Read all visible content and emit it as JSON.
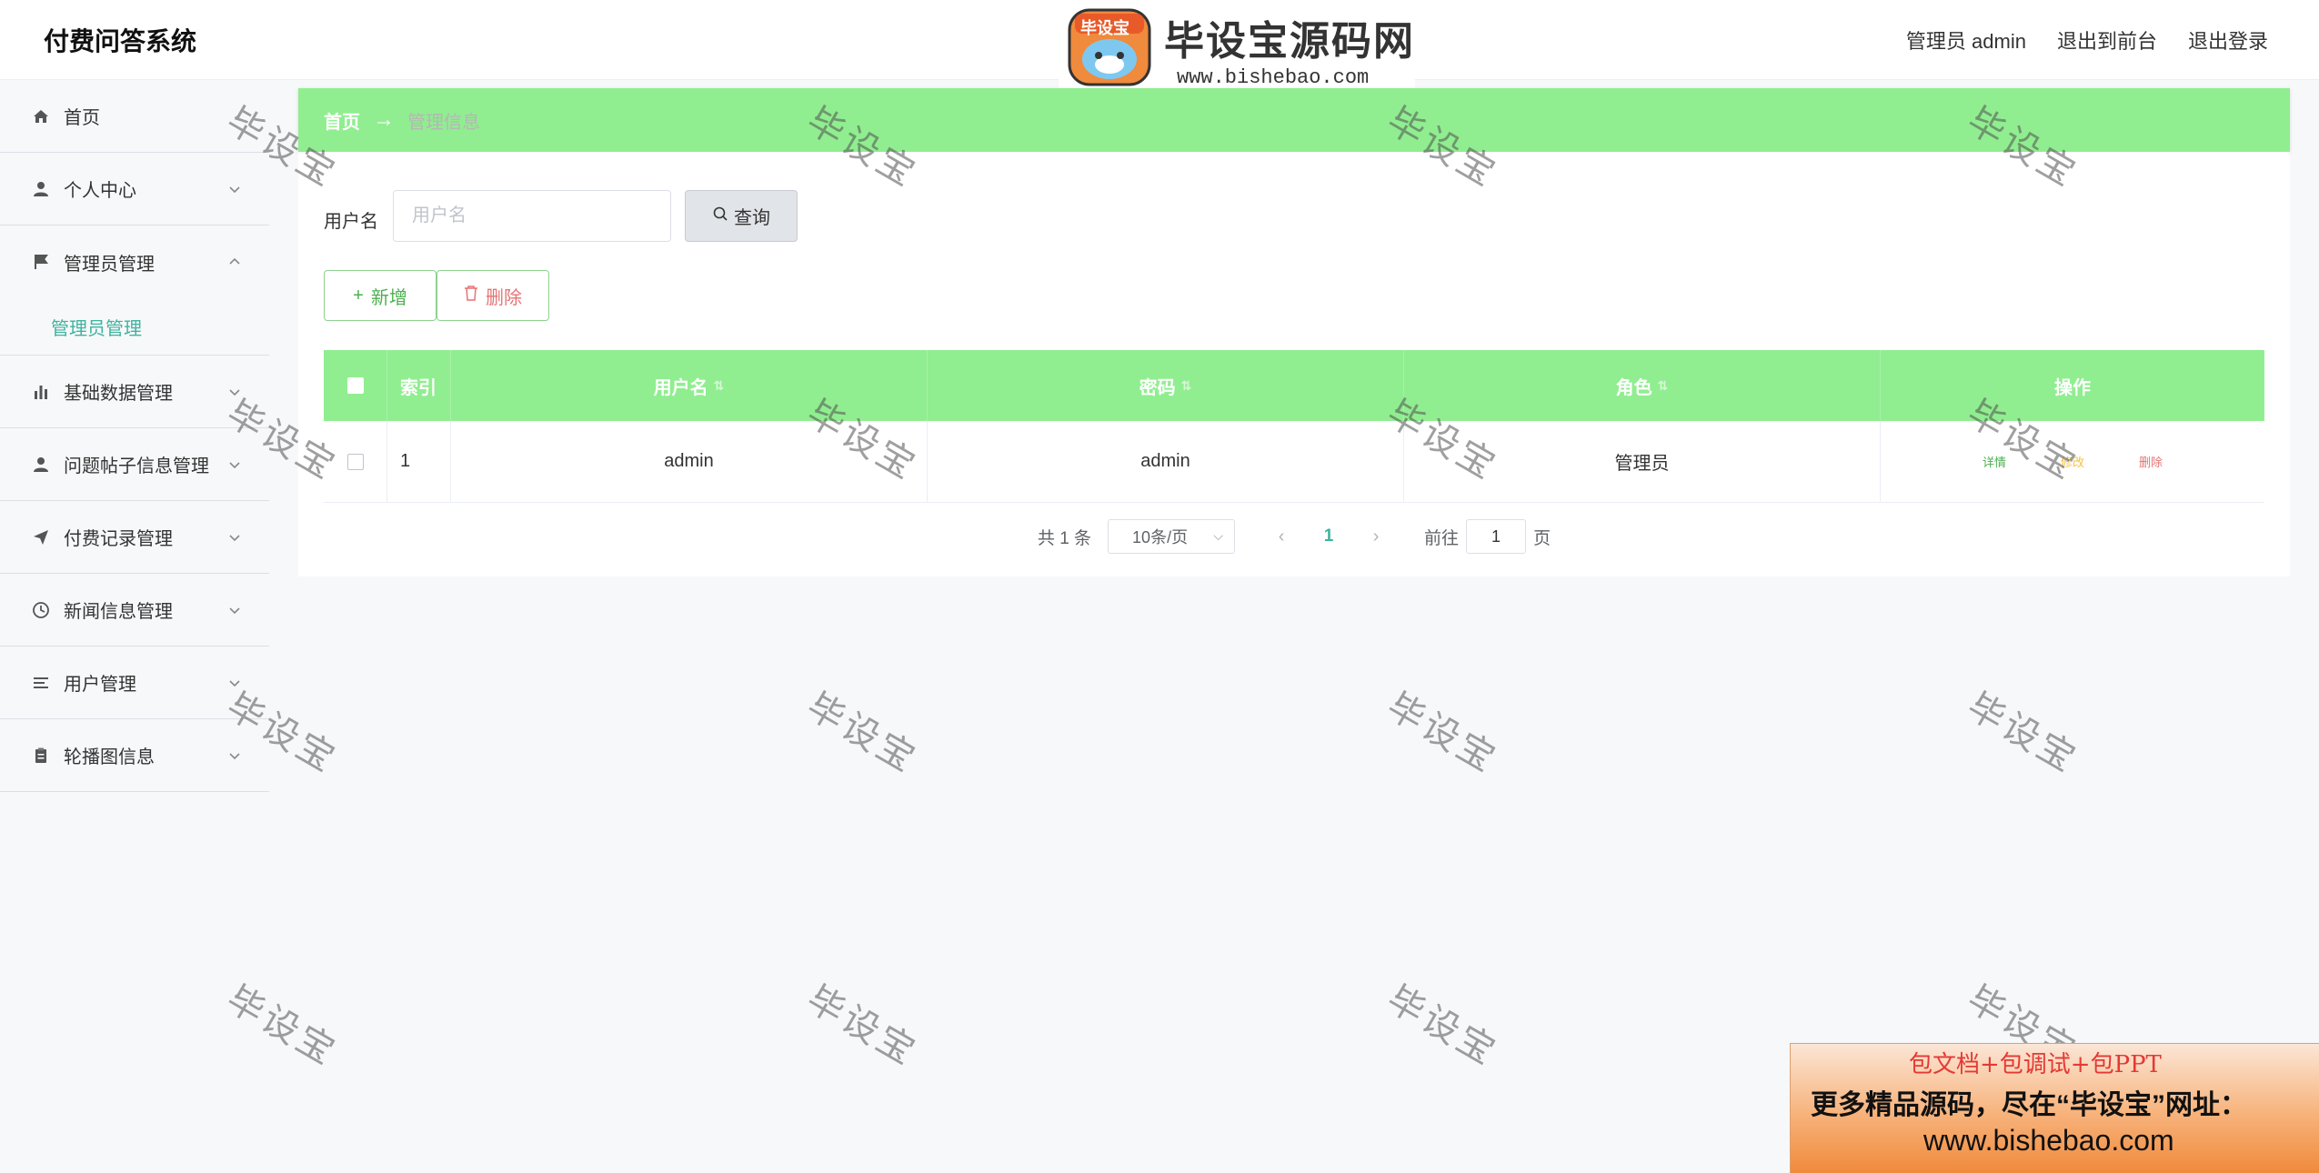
{
  "app": {
    "title": "付费问答系统"
  },
  "header": {
    "user_label": "管理员 admin",
    "front_link": "退出到前台",
    "logout_link": "退出登录"
  },
  "logo": {
    "brand": "毕设宝源码网",
    "url": "www.bishebao.com",
    "badge": "毕设宝"
  },
  "sidebar": {
    "items": [
      {
        "label": "首页",
        "icon": "home-icon"
      },
      {
        "label": "个人中心",
        "icon": "user-icon"
      },
      {
        "label": "管理员管理",
        "icon": "flag-icon",
        "expanded": true,
        "children": [
          {
            "label": "管理员管理"
          }
        ]
      },
      {
        "label": "基础数据管理",
        "icon": "bar-chart-icon"
      },
      {
        "label": "问题帖子信息管理",
        "icon": "user-icon"
      },
      {
        "label": "付费记录管理",
        "icon": "send-icon"
      },
      {
        "label": "新闻信息管理",
        "icon": "clock-icon"
      },
      {
        "label": "用户管理",
        "icon": "list-icon"
      },
      {
        "label": "轮播图信息",
        "icon": "clipboard-icon"
      }
    ]
  },
  "breadcrumb": {
    "home": "首页",
    "current": "管理信息"
  },
  "search": {
    "label": "用户名",
    "placeholder": "用户名",
    "button": "查询"
  },
  "actions": {
    "add": "新增",
    "delete": "删除"
  },
  "table": {
    "columns": [
      "索引",
      "用户名",
      "密码",
      "角色",
      "操作"
    ],
    "rows": [
      {
        "index": "1",
        "username": "admin",
        "password": "admin",
        "role": "管理员",
        "ops": [
          "详情",
          "修改",
          "删除"
        ]
      }
    ]
  },
  "pagination": {
    "total": "共 1 条",
    "page_size": "10条/页",
    "current_page": "1",
    "goto_label": "前往",
    "goto_value": "1",
    "page_unit": "页"
  },
  "watermark": {
    "text": "毕设宝"
  },
  "ad": {
    "line1": "包文档+包调试+包PPT",
    "line2": "更多精品源码，尽在“毕设宝”网址：",
    "line3": "www.bishebao.com"
  },
  "colors": {
    "accent_green": "#90ee90",
    "active_teal": "#3fb3a0",
    "danger": "#e57373"
  }
}
